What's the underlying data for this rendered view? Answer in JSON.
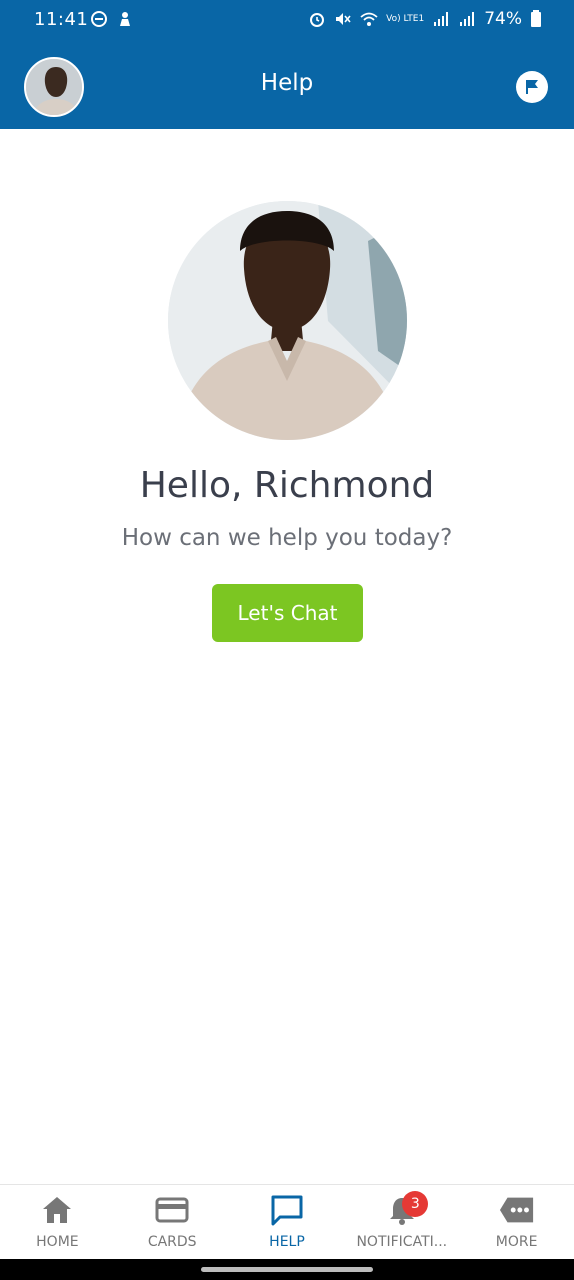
{
  "status_bar": {
    "time": "11:41",
    "battery": "74%",
    "network": "Vo) LTE1"
  },
  "header": {
    "title": "Help",
    "avatar_icon": "user-avatar",
    "action_icon": "flag-icon"
  },
  "main": {
    "greeting": "Hello, Richmond",
    "subtext": "How can we help you today?",
    "chat_button": "Let's Chat"
  },
  "bottom_nav": {
    "items": [
      {
        "label": "HOME",
        "icon": "home-icon",
        "active": false
      },
      {
        "label": "CARDS",
        "icon": "card-icon",
        "active": false
      },
      {
        "label": "HELP",
        "icon": "chat-icon",
        "active": true
      },
      {
        "label": "NOTIFICATI...",
        "icon": "bell-icon",
        "active": false,
        "badge": "3"
      },
      {
        "label": "MORE",
        "icon": "more-icon",
        "active": false
      }
    ]
  },
  "colors": {
    "primary": "#0966a6",
    "accent": "#7cc622",
    "badge": "#e53935"
  }
}
